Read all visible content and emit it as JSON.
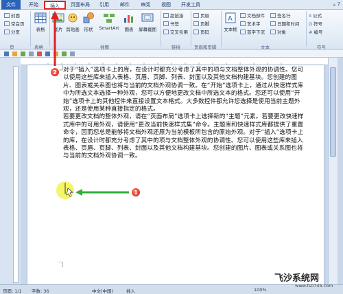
{
  "tabs": [
    {
      "label": "文件"
    },
    {
      "label": "开始"
    },
    {
      "label": "插入"
    },
    {
      "label": "页面布局"
    },
    {
      "label": "引用"
    },
    {
      "label": "邮件"
    },
    {
      "label": "审阅"
    },
    {
      "label": "视图"
    },
    {
      "label": "开发工具"
    }
  ],
  "ribbon": {
    "pages_group": {
      "items": [
        "封面",
        "空白页",
        "分页"
      ],
      "label": "页"
    },
    "table": {
      "label": "表格",
      "group": "表格"
    },
    "illustrations": {
      "buttons": [
        "图片",
        "剪贴画",
        "形状",
        "SmartArt",
        "图表",
        "屏幕截图"
      ],
      "label": "插图"
    },
    "links": {
      "items": [
        "超链接",
        "书签",
        "交叉引用"
      ],
      "label": "链接"
    },
    "header_footer": {
      "items": [
        "页眉",
        "页脚",
        "页码"
      ],
      "label": "页眉和页脚"
    },
    "text": {
      "textbox": "文本框",
      "items_a": [
        "文档部件",
        "艺术字",
        "首字下沉"
      ],
      "items_b": [
        "签名行",
        "日期和时间",
        "对象"
      ],
      "label": "文本"
    },
    "symbols": {
      "items": [
        "公式",
        "符号",
        "编号"
      ],
      "label": "符号"
    }
  },
  "document": {
    "paragraphs": [
      "对于“插入”选项卡上的库，在设计时都充分考虑了其中的项与文档整体外观的协调性。您可以使用这些库来插入表格、页眉、页脚、列表、封面以及其他文档构建基块。您创建的图片、图表或关系图也将与当前的文档外观协调一致。在“开始”选项卡上，通过从快速样式库中为所选文本选择一种外观，您可以方便地更改文档中所选文本的格式。您还可以使用“开始”选项卡上的其他控件来直接设置文本格式。大多数控件都允许您选择是使用当前主题外观，还是使用某种直接指定的格式。",
      "若要更改文档的整体外观，请在“页面布局”选项卡上选择新的“主题”元素。若要更改快速样式库中的可用外观，请使用“更改当前快速样式集”命令。主题库和快速样式库都提供了重置命令，因而您总是能够将文档外观还原为当前模板所包含的原始外观。对于“插入”选项卡上的库，在设计时都充分考虑了其中的项与文档整体外观的协调性。您可以使用这些库来插入表格、页眉、页脚、列表、封面以及其他文档构建基块。您创建的图片、图表或关系图也将与当前的文档外观协调一致。"
    ]
  },
  "status": {
    "page": "页面: 1/1",
    "words": "字数: 36",
    "lang": "中文(中国)",
    "mode": "插入",
    "zoom": "100%"
  },
  "annotations": {
    "step1": "1",
    "step2": "2"
  },
  "watermark": {
    "brand": "飞沙系统网",
    "url": "www.fs0745.com"
  },
  "colors": {
    "accent": "#2b63b8",
    "annotation": "#e02020",
    "arrow": "#2fae3a",
    "highlight": "#f2f23a"
  }
}
